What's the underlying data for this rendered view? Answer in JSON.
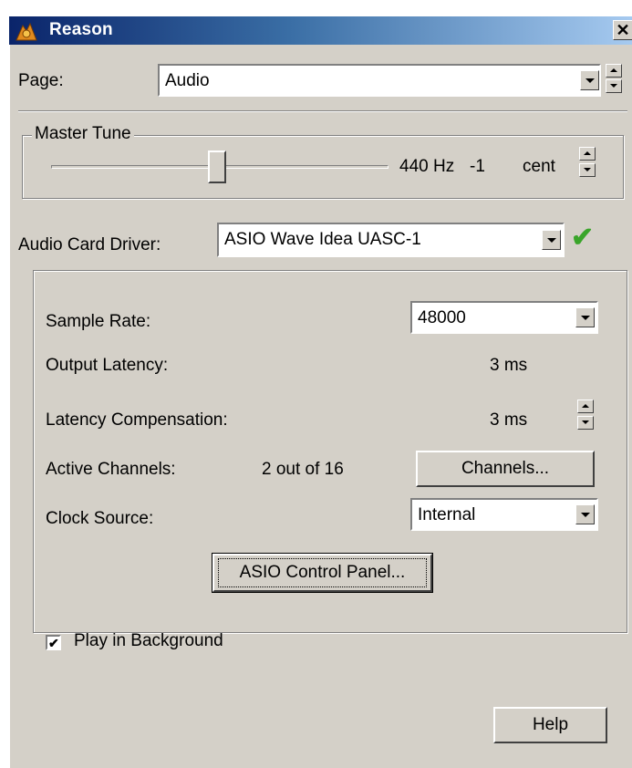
{
  "window": {
    "title": "Reason",
    "close_glyph": "✕",
    "app_icon": "reason-app-icon"
  },
  "page": {
    "label": "Page:",
    "value": "Audio"
  },
  "master_tune": {
    "group_label": "Master Tune",
    "value_hz": "440 Hz",
    "value_cent_num": "-1",
    "unit": "cent",
    "slider_fraction": 0.5
  },
  "audio_card_driver": {
    "label": "Audio Card Driver:",
    "value": "ASIO Wave Idea UASC-1",
    "status_icon": "green-check-icon",
    "status_glyph": "✔"
  },
  "settings": {
    "sample_rate": {
      "label": "Sample Rate:",
      "value": "48000"
    },
    "output_latency": {
      "label": "Output Latency:",
      "value": "3 ms"
    },
    "latency_compensation": {
      "label": "Latency Compensation:",
      "value": "3 ms"
    },
    "active_channels": {
      "label": "Active Channels:",
      "value": "2 out of 16",
      "button": "Channels..."
    },
    "clock_source": {
      "label": "Clock Source:",
      "value": "Internal"
    },
    "asio_button": "ASIO Control Panel..."
  },
  "play_in_background": {
    "label": "Play in Background",
    "checked": true,
    "check_glyph": "✔"
  },
  "help_button": "Help",
  "colors": {
    "dialog_bg": "#d4d0c8",
    "titlebar_start": "#0a246a",
    "titlebar_end": "#a6caf0",
    "ok_green": "#3aa52a"
  }
}
